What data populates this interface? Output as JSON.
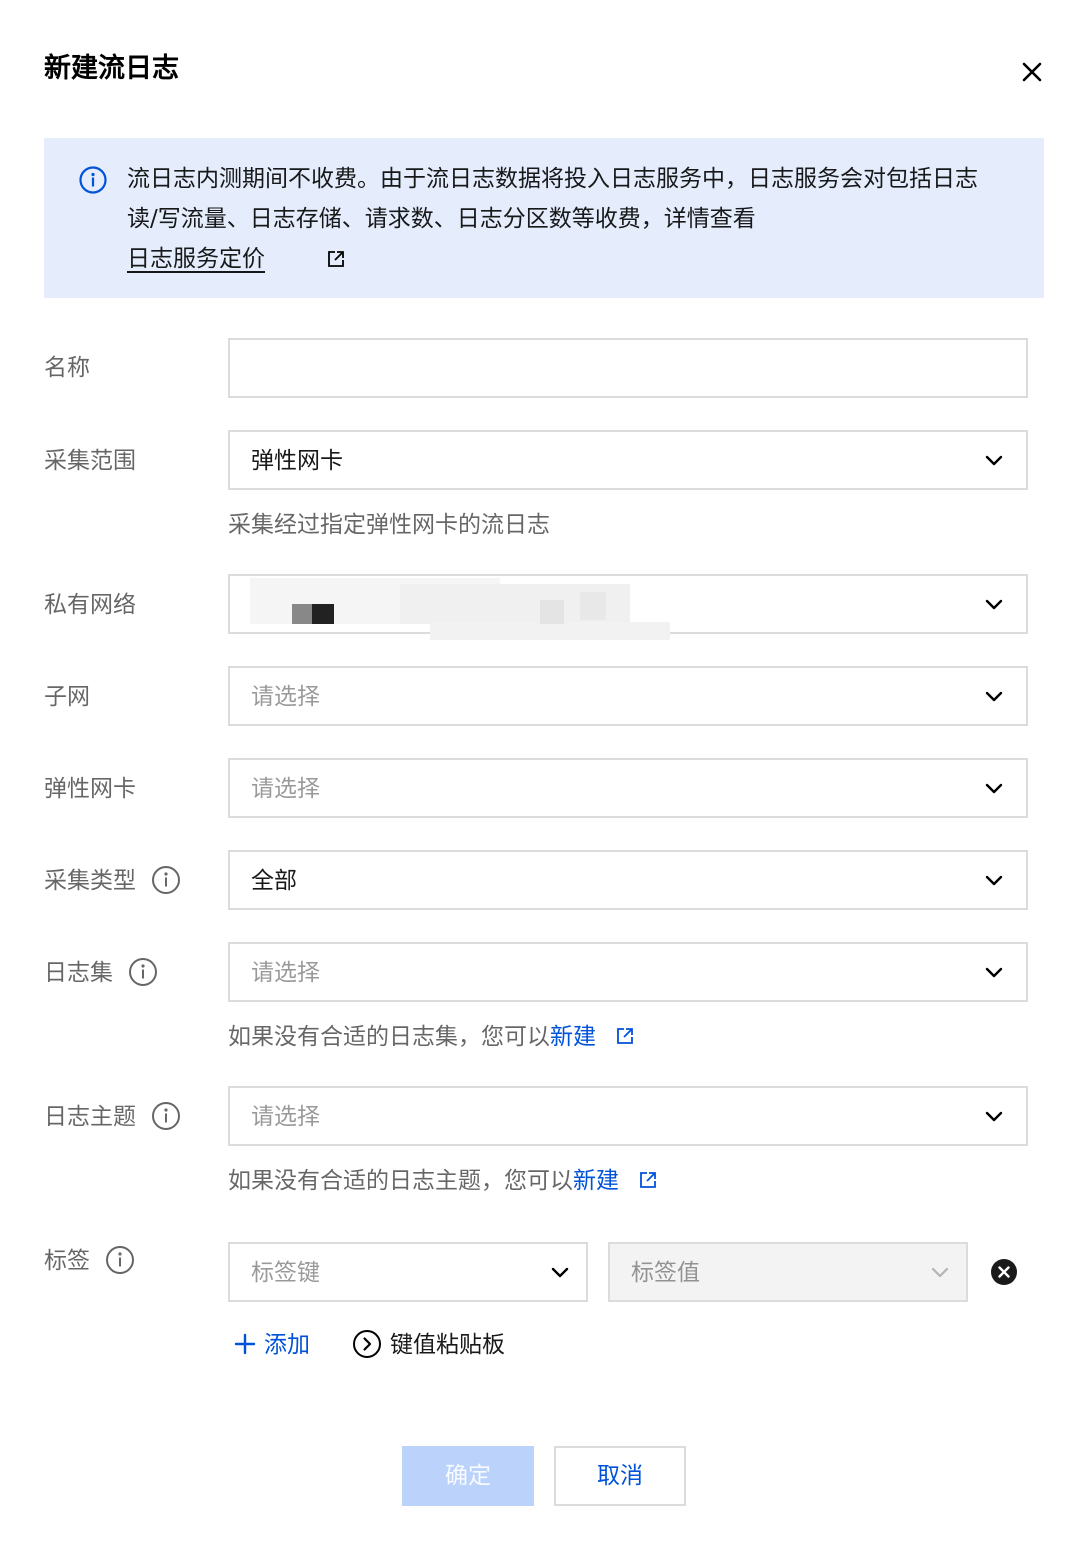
{
  "dialog": {
    "title": "新建流日志",
    "close_icon": "close-icon"
  },
  "notice": {
    "icon": "info-circle-icon",
    "text": "流日志内测期间不收费。由于流日志数据将投入日志服务中，日志服务会对包括日志读/写流量、日志存储、请求数、日志分区数等收费，详情查看",
    "link_label": "日志服务定价",
    "link_icon": "external-link-icon"
  },
  "form": {
    "name": {
      "label": "名称",
      "value": ""
    },
    "scope": {
      "label": "采集范围",
      "value": "弹性网卡",
      "help": "采集经过指定弹性网卡的流日志"
    },
    "vpc": {
      "label": "私有网络"
    },
    "subnet": {
      "label": "子网",
      "placeholder": "请选择"
    },
    "eni": {
      "label": "弹性网卡",
      "placeholder": "请选择"
    },
    "collect_type": {
      "label": "采集类型",
      "value": "全部"
    },
    "logset": {
      "label": "日志集",
      "placeholder": "请选择",
      "help_prefix": "如果没有合适的日志集，您可以",
      "help_link": "新建"
    },
    "topic": {
      "label": "日志主题",
      "placeholder": "请选择",
      "help_prefix": "如果没有合适的日志主题，您可以",
      "help_link": "新建"
    },
    "tags": {
      "label": "标签",
      "key_placeholder": "标签键",
      "value_placeholder": "标签值",
      "add_label": "添加",
      "paste_label": "键值粘贴板"
    }
  },
  "footer": {
    "confirm_label": "确定",
    "cancel_label": "取消"
  },
  "colors": {
    "primary": "#0052d9",
    "notice_bg": "#e5edfc",
    "confirm_disabled": "#bbd3fb"
  }
}
